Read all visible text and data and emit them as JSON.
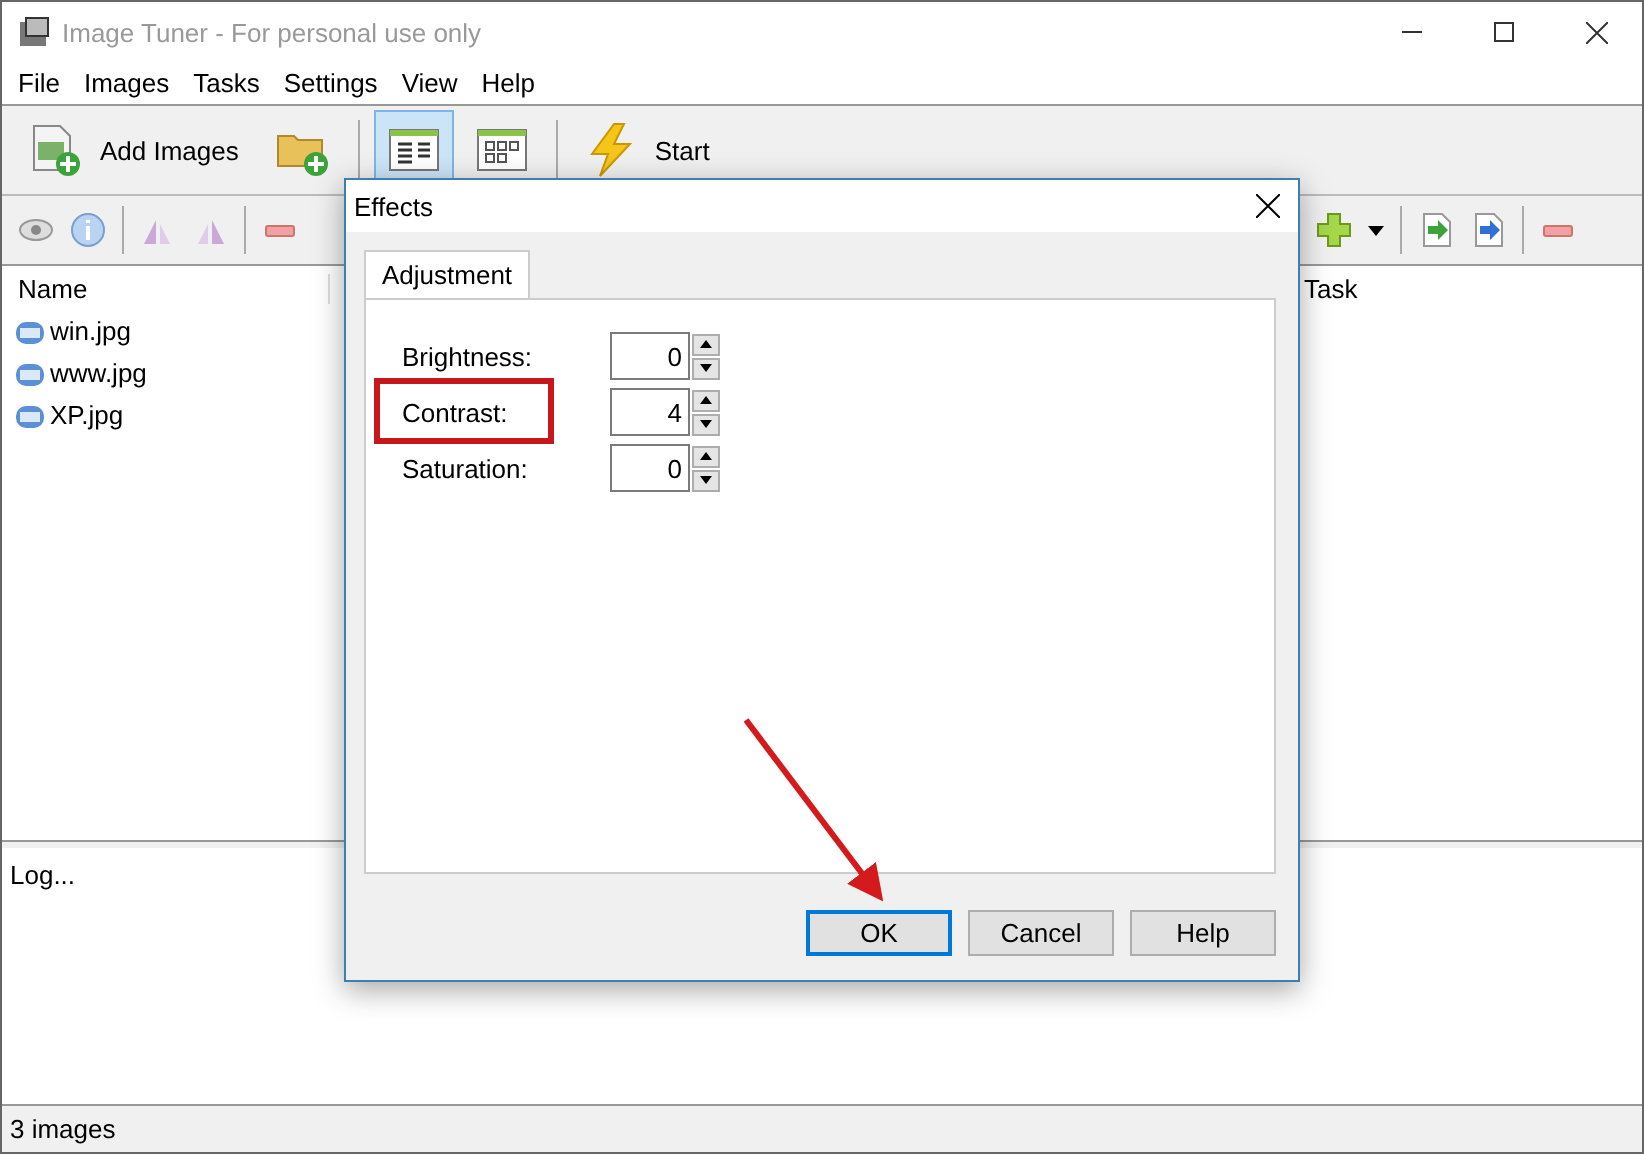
{
  "window": {
    "title": "Image Tuner - For personal use only"
  },
  "menu": [
    "File",
    "Images",
    "Tasks",
    "Settings",
    "View",
    "Help"
  ],
  "toolbar": [
    {
      "kind": "add-images",
      "label": "Add Images",
      "selected": false
    },
    {
      "kind": "add-folder",
      "selected": false
    },
    {
      "kind": "list-view",
      "selected": true
    },
    {
      "kind": "thumb-view",
      "selected": false
    },
    {
      "kind": "start",
      "label": "Start",
      "selected": false
    }
  ],
  "image_list": {
    "columns": [
      "Name"
    ],
    "files": [
      "win.jpg",
      "www.jpg",
      "XP.jpg"
    ]
  },
  "task_list": {
    "columns": [
      "Task"
    ]
  },
  "log": "Log...",
  "status_bar": "3 images",
  "dialog": {
    "title": "Effects",
    "tabs": [
      {
        "label": "Adjustment",
        "selected": true
      }
    ],
    "fields": [
      {
        "label": "Brightness:",
        "value": "0",
        "highlighted": false
      },
      {
        "label": "Contrast:",
        "value": "4",
        "highlighted": true
      },
      {
        "label": "Saturation:",
        "value": "0",
        "highlighted": false
      }
    ],
    "buttons": [
      {
        "label": "OK",
        "default": true
      },
      {
        "label": "Cancel",
        "default": false
      },
      {
        "label": "Help",
        "default": false
      }
    ]
  }
}
